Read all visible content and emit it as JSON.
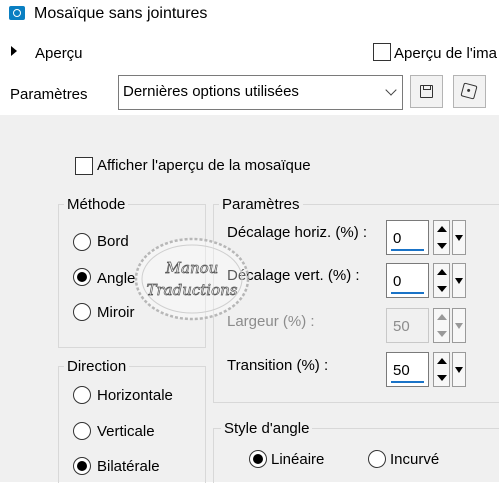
{
  "window": {
    "title": "Mosaïque sans jointures"
  },
  "preview": {
    "label": "Aperçu",
    "image_preview_label": "Aperçu de l'ima",
    "image_preview_checked": false
  },
  "presets": {
    "label": "Paramètres",
    "value": "Dernières options utilisées",
    "icons": [
      "save-icon",
      "dice-icon"
    ]
  },
  "options": {
    "show_preview_label": "Afficher l'aperçu de la mosaïque",
    "show_preview_checked": false
  },
  "methode": {
    "title": "Méthode",
    "items": [
      {
        "label": "Bord",
        "checked": false
      },
      {
        "label": "Angle",
        "checked": true
      },
      {
        "label": "Miroir",
        "checked": false
      }
    ]
  },
  "direction": {
    "title": "Direction",
    "items": [
      {
        "label": "Horizontale",
        "checked": false
      },
      {
        "label": "Verticale",
        "checked": false
      },
      {
        "label": "Bilatérale",
        "checked": true
      }
    ]
  },
  "parametres": {
    "title": "Paramètres",
    "fields": [
      {
        "label": "Décalage horiz. (%) :",
        "value": "0",
        "enabled": true
      },
      {
        "label": "Décalage vert. (%) :",
        "value": "0",
        "enabled": true
      },
      {
        "label": "Largeur (%) :",
        "value": "50",
        "enabled": false
      },
      {
        "label": "Transition (%) :",
        "value": "50",
        "enabled": true
      }
    ]
  },
  "style_angle": {
    "title": "Style d'angle",
    "items": [
      {
        "label": "Linéaire",
        "checked": true
      },
      {
        "label": "Incurvé",
        "checked": false
      }
    ]
  },
  "watermark": {
    "line1": "Manou",
    "line2": "Traductions"
  },
  "colors": {
    "accent": "#1a73c7",
    "panel_bg": "#f0f0f0",
    "app_icon": "#0a7fc2"
  }
}
